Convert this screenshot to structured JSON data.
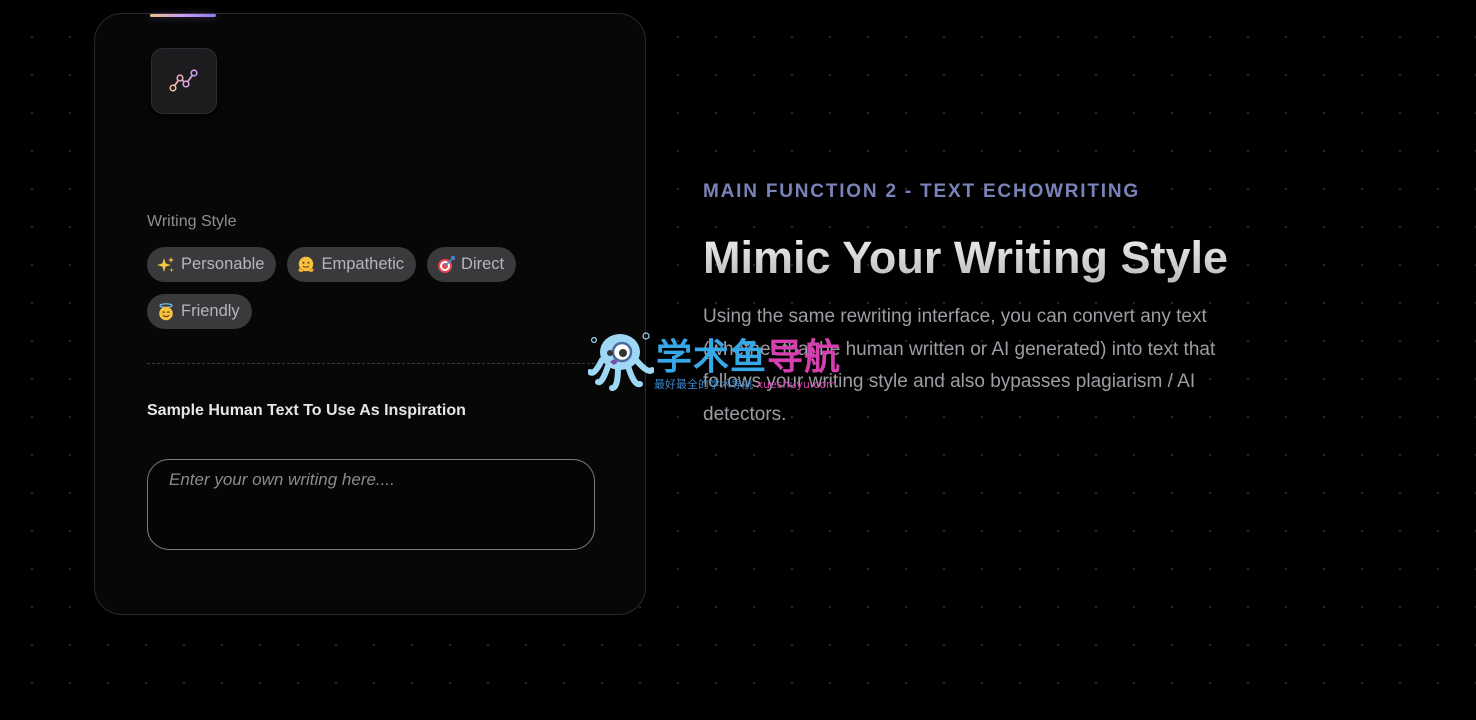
{
  "card": {
    "icon": "trend-line-icon",
    "writing_style_label": "Writing Style",
    "chips": [
      {
        "label": "Personable",
        "icon": "sparkles-icon"
      },
      {
        "label": "Empathetic",
        "icon": "hugging-face-icon"
      },
      {
        "label": "Direct",
        "icon": "bullseye-icon"
      },
      {
        "label": "Friendly",
        "icon": "smiling-halo-face-icon"
      }
    ],
    "sample_label": "Sample Human Text To Use As Inspiration",
    "sample_placeholder": "Enter your own writing here....",
    "sample_value": ""
  },
  "feature": {
    "eyebrow": "MAIN FUNCTION 2 - TEXT ECHOWRITING",
    "title": "Mimic Your Writing Style",
    "body": "Using the same rewriting interface, you can convert any text (whether that be human written or AI generated) into text that follows your writing style and also bypasses plagiarism / AI detectors."
  },
  "watermark": {
    "title_part1": "学术鱼",
    "title_part2": "导航",
    "subtitle_part1": "最好最全的学术导航",
    "subtitle_part2": "xueshuyu.com"
  },
  "colors": {
    "background": "#000000",
    "card_bg": "#070708",
    "chip_bg": "#3a3a3d",
    "eyebrow": "#7a83b8",
    "accent_gradient": [
      "#f0c080",
      "#c79cf5",
      "#8a7cf0"
    ],
    "watermark_blue": "#36a8e8",
    "watermark_pink": "#d63fb0"
  }
}
